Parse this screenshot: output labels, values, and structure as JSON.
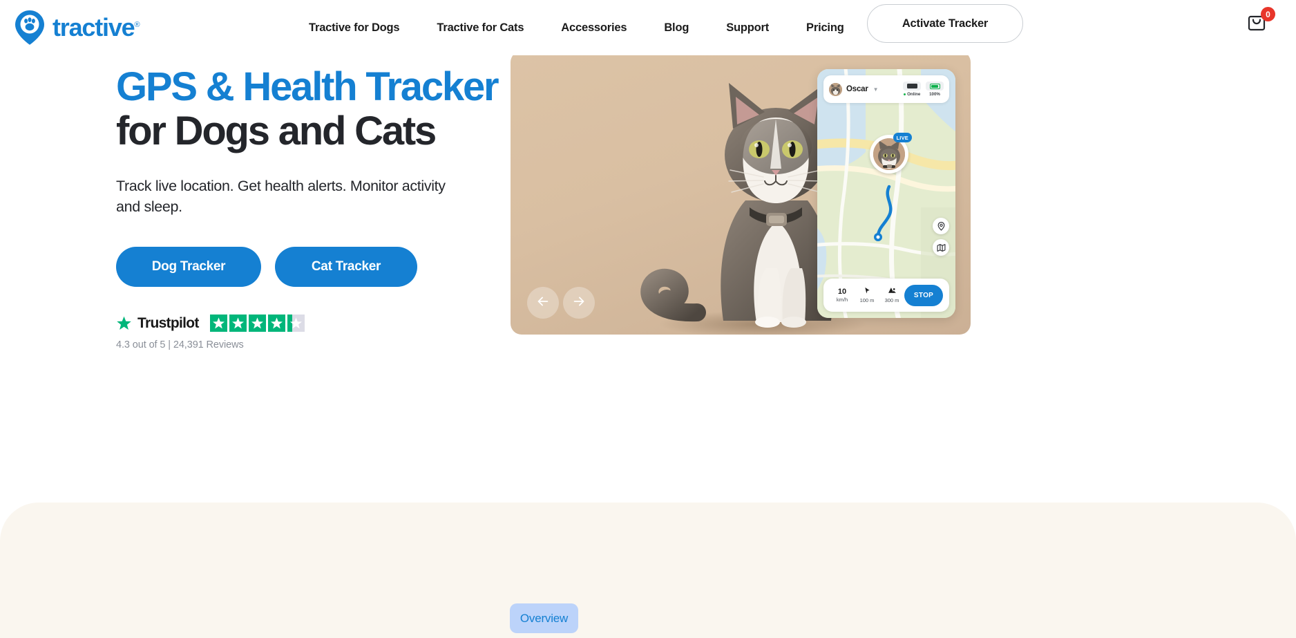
{
  "header": {
    "logo_text": "tractive",
    "logo_reg": "®",
    "logo_icon": "paw-pin-icon",
    "nav": [
      {
        "label": "Tractive for Dogs"
      },
      {
        "label": "Tractive for Cats"
      },
      {
        "label": "Accessories"
      },
      {
        "label": "Blog"
      },
      {
        "label": "Support"
      },
      {
        "label": "Pricing"
      }
    ],
    "activate_label": "Activate Tracker",
    "cart_icon": "shopping-bag-icon",
    "cart_count": "0"
  },
  "hero": {
    "title_line1": "GPS & Health Tracker",
    "title_line2": "for Dogs and Cats",
    "subtitle": "Track live location. Get health alerts. Monitor activity and sleep.",
    "cta_dog": "Dog Tracker",
    "cta_cat": "Cat Tracker",
    "prev_icon": "arrow-left-icon",
    "next_icon": "arrow-right-icon"
  },
  "trustpilot": {
    "brand": "Trustpilot",
    "star_icon": "star-icon",
    "rating": 4.3,
    "max_rating": 5,
    "filled_stars": 4,
    "partial_fraction": 0.3,
    "meta": "4.3 out of 5 | 24,391 Reviews"
  },
  "app_preview": {
    "pet_name": "Oscar",
    "avatar_icon": "pet-avatar",
    "chevron_icon": "chevron-down-icon",
    "tracker_icon": "tracker-device-icon",
    "status_label": "Online",
    "battery_icon": "battery-icon",
    "battery_label": "100%",
    "live_badge": "LIVE",
    "pin_icon": "pet-location-pin",
    "map_controls": [
      {
        "icon": "location-pin-icon"
      },
      {
        "icon": "map-layers-icon"
      }
    ],
    "footer_stats": [
      {
        "value": "10",
        "label": "km/h",
        "icon": ""
      },
      {
        "value": "",
        "label": "100 m",
        "icon": "cursor-icon"
      },
      {
        "value": "",
        "label": "300 m",
        "icon": "mountain-icon"
      }
    ],
    "stop_label": "STOP"
  },
  "section": {
    "overview_label": "Overview"
  },
  "colors": {
    "brand_blue": "#1580d2",
    "text_dark": "#24262b",
    "trust_green": "#00b67a",
    "badge_red": "#e8352a",
    "cream": "#faf6ef",
    "pill_blue": "#bcd3fa",
    "hero_tan": "#d9bfa2"
  }
}
